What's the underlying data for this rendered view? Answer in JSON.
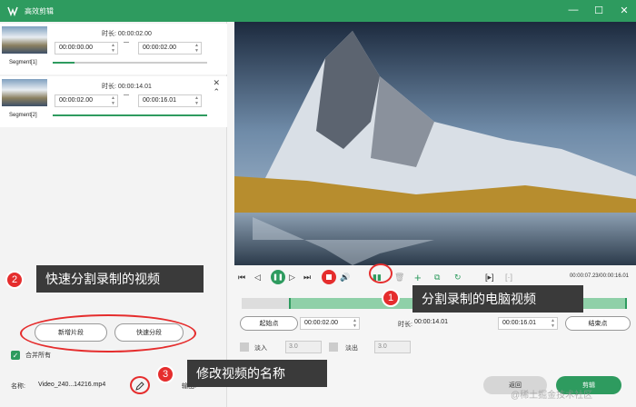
{
  "window": {
    "title": "高效剪辑"
  },
  "segments": [
    {
      "label": "Segment[1]",
      "duration_label": "时长:",
      "duration": "00:00:02.00",
      "start": "00:00:00.00",
      "end": "00:00:02.00"
    },
    {
      "label": "Segment[2]",
      "duration_label": "时长:",
      "duration": "00:00:14.01",
      "start": "00:00:02.00",
      "end": "00:00:16.01"
    }
  ],
  "left_buttons": {
    "new_segment": "新增片段",
    "fast_split": "快速分段"
  },
  "merge_all": "合并所有",
  "callouts": {
    "c1": {
      "num": "1",
      "text": "分割录制的电脑视频"
    },
    "c2": {
      "num": "2",
      "text": "快速分割录制的视频"
    },
    "c3": {
      "num": "3",
      "text": "修改视频的名称"
    }
  },
  "file": {
    "name_label": "名称:",
    "name": "Video_240...14216.mp4",
    "output_label": "输出:"
  },
  "player": {
    "time": "00:00:07.23/00:00:16.01"
  },
  "edit": {
    "start_btn": "起始点",
    "start_time": "00:00:02.00",
    "duration_label": "时长:",
    "duration": "00:00:14.01",
    "end_time": "00:00:16.01",
    "end_btn": "结束点"
  },
  "fade": {
    "fade_in": "淡入",
    "fade_in_val": "3.0",
    "fade_out": "淡出",
    "fade_out_val": "3.0"
  },
  "actions": {
    "back": "返回",
    "confirm": "剪辑"
  },
  "watermark": "@稀土掘金技术社区",
  "colors": {
    "accent": "#2e9b5f",
    "callout": "#3a3a3a",
    "badge": "#e52d2d"
  }
}
